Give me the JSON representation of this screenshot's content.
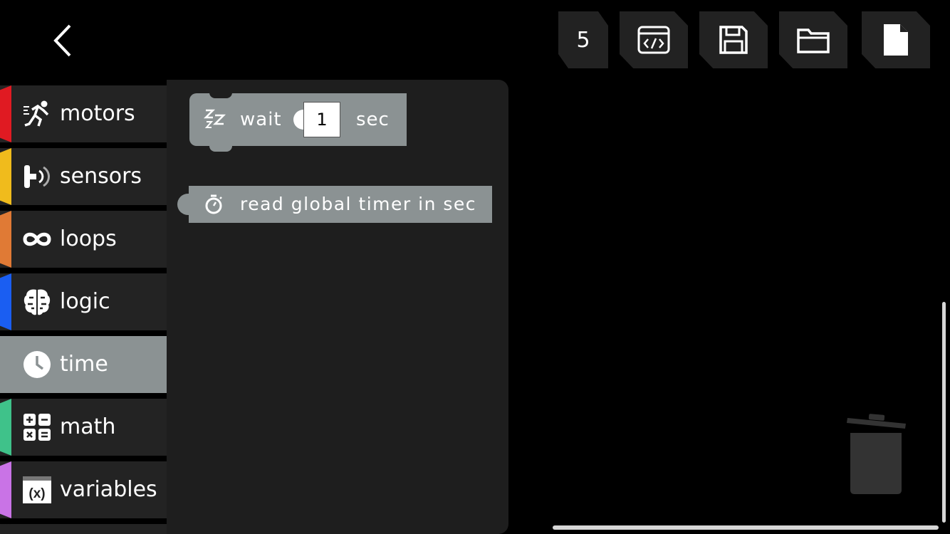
{
  "toolbar": {
    "block_count": "5",
    "buttons": [
      "code-view",
      "save",
      "open-folder",
      "new-file"
    ]
  },
  "categories": [
    {
      "label": "motors",
      "color": "#e01a22",
      "icon": "running-person-icon"
    },
    {
      "label": "sensors",
      "color": "#f0bb1c",
      "icon": "sensor-icon"
    },
    {
      "label": "loops",
      "color": "#e07a35",
      "icon": "infinity-icon"
    },
    {
      "label": "logic",
      "color": "#1a5ef2",
      "icon": "brain-icon"
    },
    {
      "label": "time",
      "color": "#8b9293",
      "icon": "clock-icon",
      "selected": true
    },
    {
      "label": "math",
      "color": "#3fc28a",
      "icon": "calculator-icon"
    },
    {
      "label": "variables",
      "color": "#c973e6",
      "icon": "variable-icon"
    }
  ],
  "flyout": {
    "wait_block": {
      "label": "wait",
      "value": "1",
      "unit": "sec",
      "icon": "sleep-icon"
    },
    "timer_block": {
      "label": "read global timer in sec",
      "icon": "stopwatch-icon"
    }
  },
  "colors": {
    "block": "#8b9293",
    "flyout_bg": "#1e1e1e",
    "category_bg": "#232323"
  }
}
